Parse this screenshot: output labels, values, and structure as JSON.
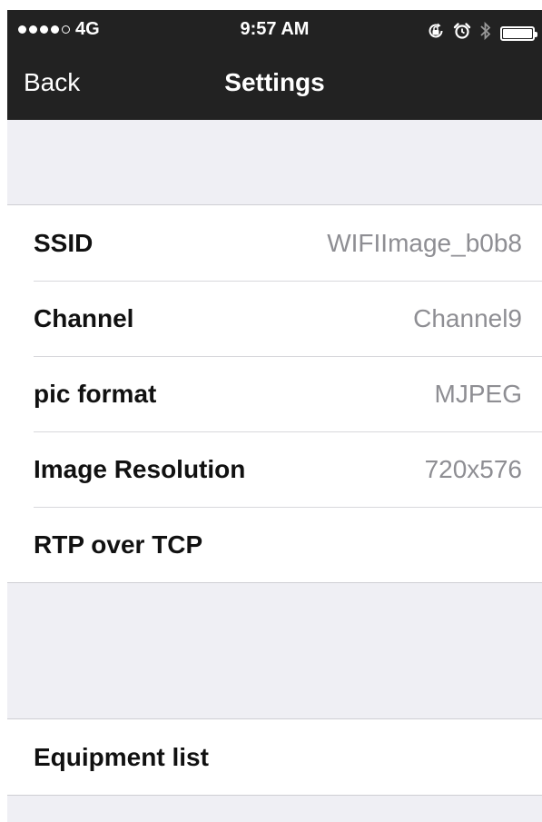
{
  "status_bar": {
    "signal_dots_filled": 4,
    "signal_dots_total": 5,
    "carrier": "4G",
    "time": "9:57 AM",
    "icons": [
      "rotation-lock-icon",
      "alarm-icon",
      "bluetooth-icon",
      "battery-icon"
    ]
  },
  "nav": {
    "back_label": "Back",
    "title": "Settings"
  },
  "settings": [
    {
      "label": "SSID",
      "value": "WIFIImage_b0b8"
    },
    {
      "label": "Channel",
      "value": "Channel9"
    },
    {
      "label": "pic format",
      "value": "MJPEG"
    },
    {
      "label": "Image Resolution",
      "value": "720x576"
    },
    {
      "label": "RTP over TCP",
      "value": ""
    }
  ],
  "equipment": {
    "label": "Equipment list"
  },
  "colors": {
    "bar_background": "#222222",
    "page_background": "#efeff4",
    "value_text": "#8e8e93"
  }
}
